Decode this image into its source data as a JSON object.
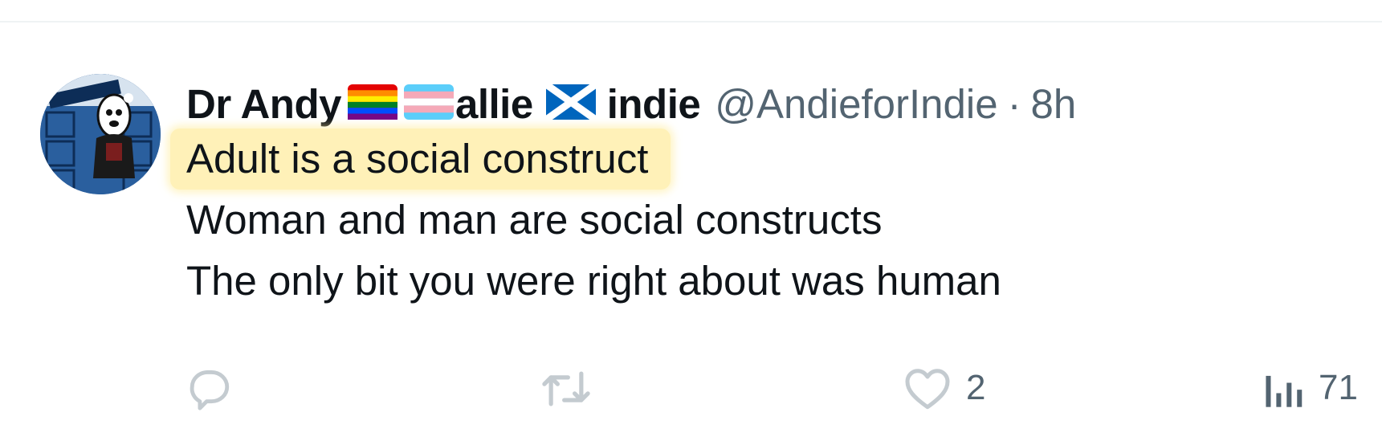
{
  "tweet": {
    "display_name": "Dr Andy",
    "name_word_1": "allie",
    "name_word_2": "indie",
    "handle": "@AndieforIndie",
    "separator": "·",
    "time": "8h",
    "lines": [
      "Adult is a social construct",
      "Woman and man are social constructs",
      "The only bit you were right about was human"
    ],
    "flags": [
      "rainbow-flag",
      "transgender-flag",
      "scotland-flag"
    ]
  },
  "actions": {
    "reply_count": "",
    "retweet_count": "",
    "like_count": "2",
    "view_count": "71"
  },
  "colors": {
    "text": "#0f1419",
    "secondary": "#536471",
    "highlight": "#fff1b8",
    "divider": "#eff3f4"
  }
}
